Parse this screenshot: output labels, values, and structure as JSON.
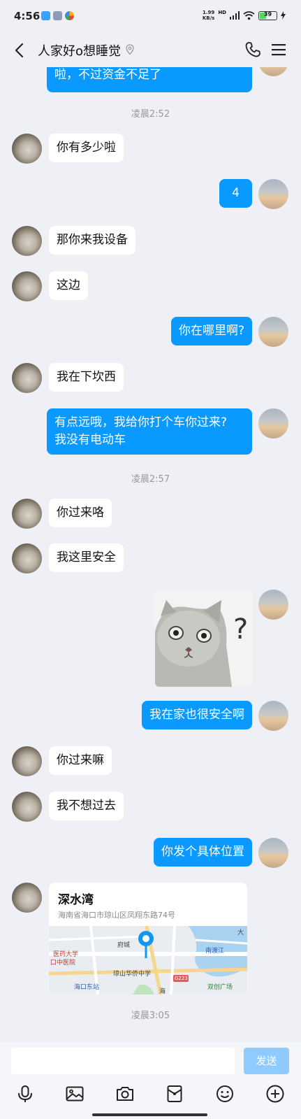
{
  "status_bar": {
    "time": "4:56",
    "speed_value": "1.99",
    "speed_unit": "KB/s",
    "hd": "HD",
    "battery": "39"
  },
  "header": {
    "title": "人家好o想睡觉"
  },
  "messages": {
    "m0": "啦，不过资金不足了",
    "t1": "凌晨2:52",
    "m1": "你有多少啦",
    "m2": "4",
    "m3": "那你来我设备",
    "m4": "这边",
    "m5": "你在哪里啊?",
    "m6": "我在下坎西",
    "m7_line1": "有点远哦，我给你打个车你过来?",
    "m7_line2": "我没有电动车",
    "t2": "凌晨2:57",
    "m8": "你过来咯",
    "m9": "我这里安全",
    "m10": "我在家也很安全啊",
    "m11": "你过来嘛",
    "m12": "我不想过去",
    "m13": "你发个具体位置",
    "t3": "凌晨3:05"
  },
  "location": {
    "name": "深水湾",
    "address": "海南省海口市琼山区凤翔东路74号",
    "map_labels": {
      "l1": "府城",
      "l2": "医药大学",
      "l3": "口中医院",
      "l4": "海口东站",
      "l5": "琼山华侨中学",
      "l6": "双创广场",
      "l7": "南渡江",
      "l8": "大",
      "l9": "G223",
      "l10": "海"
    }
  },
  "input": {
    "placeholder": "",
    "send_label": "发送"
  },
  "colors": {
    "accent": "#0a99ff",
    "send_disabled": "#8fcbff",
    "background": "#eff0f5"
  }
}
